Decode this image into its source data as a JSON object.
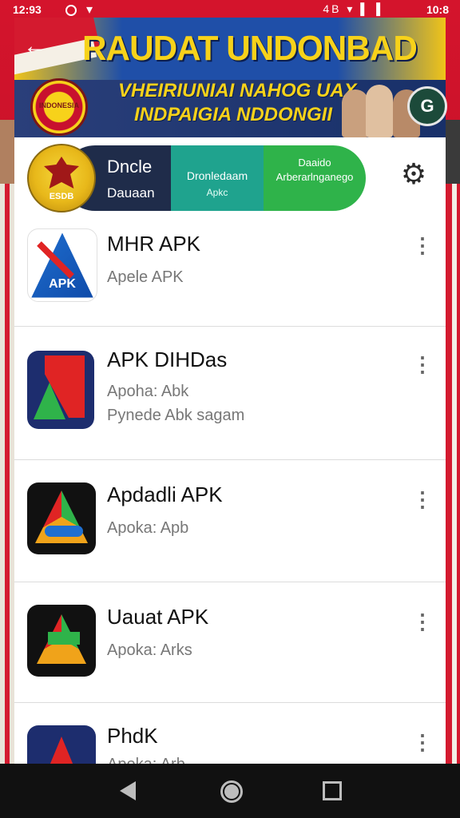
{
  "status_bar": {
    "time": "12:93",
    "wifi_icon": "wifi-icon",
    "right_icons": "4B ▾ ▌ ▌",
    "right_time": "10:8"
  },
  "banner": {
    "title": "RAUDAT  UNDONBAD",
    "subtitle_1": "VHEIRIUNIAI NAHOG UAX",
    "subtitle_2": "INDPAIGIA NDDONGII",
    "emblem_text": "INDONESIA",
    "badge": "G",
    "back_icon": "arrow-left-icon"
  },
  "header": {
    "avatar_label": "ESDB",
    "seg1_title": "Dncle",
    "seg1_sub": "Dauaan",
    "seg2_title": "Dronledaam",
    "seg2_sub": "Apkc",
    "seg3_title": "Daaido",
    "seg3_sub": "Arberarlnganego",
    "settings_icon": "gear-icon"
  },
  "apps": [
    {
      "title": "MHR  APK",
      "line1": "Apele APK",
      "line2": "",
      "icon_label": "APK"
    },
    {
      "title": "APK  DIHDas",
      "line1": "Apoha: Abk",
      "line2": "Pynede Abk  sagam",
      "icon_label": ""
    },
    {
      "title": "Apdadli APK",
      "line1": "Apoka: Apb",
      "line2": "",
      "icon_label": ""
    },
    {
      "title": "Uauat APK",
      "line1": "Apoka: Arks",
      "line2": "",
      "icon_label": ""
    },
    {
      "title": "PhdK",
      "line1": "Apoka: Arb",
      "line2": "",
      "icon_label": ""
    }
  ],
  "nav": {
    "back": "back-triangle-icon",
    "home": "home-circle-icon",
    "recent": "recent-square-icon"
  },
  "colors": {
    "accent_red": "#c8102e",
    "banner_yellow": "#f7d21a",
    "seg_dark": "#1f2c4a",
    "seg_teal": "#1fa38e",
    "seg_green": "#2fb34a"
  }
}
